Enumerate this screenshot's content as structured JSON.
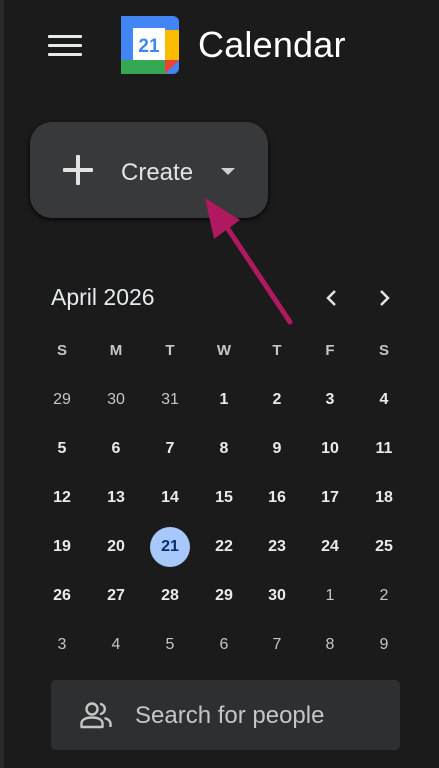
{
  "app": {
    "title": "Calendar",
    "logo_day": "21"
  },
  "create_button": {
    "label": "Create"
  },
  "mini_calendar": {
    "month_label": "April 2026",
    "weekdays": [
      "S",
      "M",
      "T",
      "W",
      "T",
      "F",
      "S"
    ],
    "weeks": [
      [
        "29",
        "30",
        "31",
        "1",
        "2",
        "3",
        "4"
      ],
      [
        "5",
        "6",
        "7",
        "8",
        "9",
        "10",
        "11"
      ],
      [
        "12",
        "13",
        "14",
        "15",
        "16",
        "17",
        "18"
      ],
      [
        "19",
        "20",
        "21",
        "22",
        "23",
        "24",
        "25"
      ],
      [
        "26",
        "27",
        "28",
        "29",
        "30",
        "1",
        "2"
      ],
      [
        "3",
        "4",
        "5",
        "6",
        "7",
        "8",
        "9"
      ]
    ],
    "today": "21"
  },
  "search_people": {
    "placeholder": "Search for people"
  },
  "colors": {
    "background": "#1b1b1c",
    "create_button": "#37393b",
    "today_highlight": "#a8c7fa",
    "annotation_arrow": "#b0185f"
  }
}
